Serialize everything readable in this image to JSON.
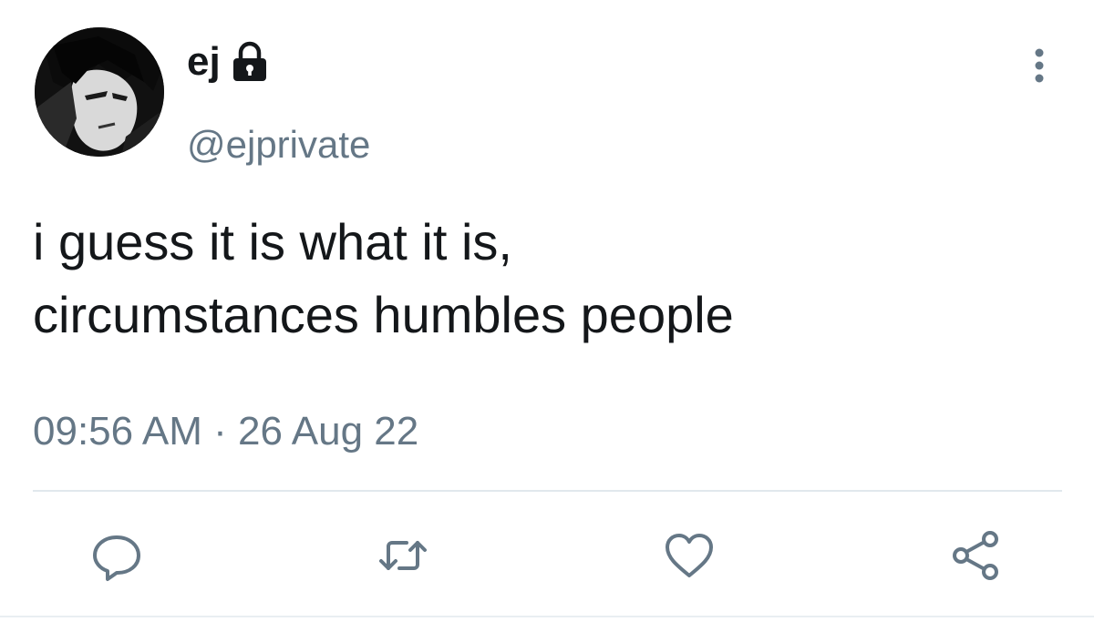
{
  "tweet": {
    "author": {
      "display_name": "ej",
      "handle": "@ejprivate",
      "protected": true
    },
    "text_lines": [
      "i guess it is what it is,",
      "circumstances humbles people"
    ],
    "time": "09:56 AM",
    "separator": "·",
    "date": "26 Aug 22"
  },
  "icons": {
    "protected": "lock-icon",
    "more": "more-vertical-icon",
    "reply": "reply-icon",
    "retweet": "retweet-icon",
    "like": "heart-icon",
    "share": "share-icon"
  },
  "colors": {
    "text": "#14171a",
    "secondary": "#657786",
    "divider": "#e1e8ed"
  }
}
